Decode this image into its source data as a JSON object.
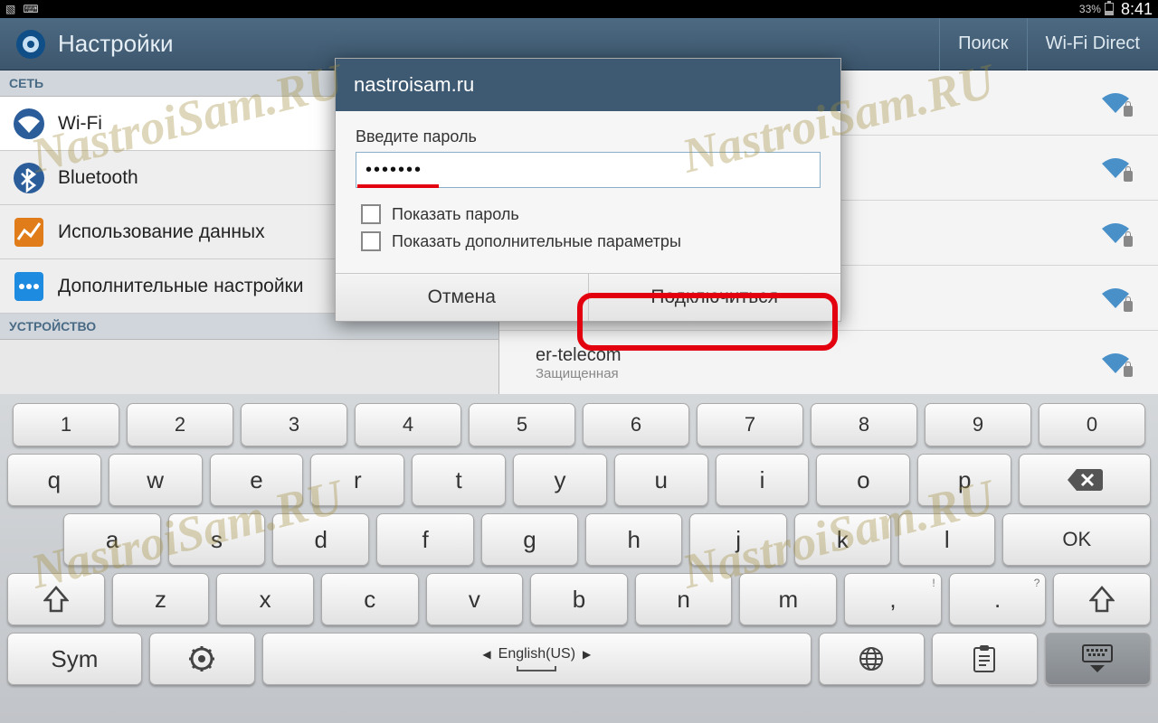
{
  "statusbar": {
    "battery_pct": "33%",
    "time": "8:41"
  },
  "actionbar": {
    "title": "Настройки",
    "search": "Поиск",
    "wifidirect": "Wi-Fi Direct"
  },
  "sections": {
    "network": "СЕТЬ",
    "device": "УСТРОЙСТВО"
  },
  "settings_items": {
    "wifi": "Wi-Fi",
    "bluetooth": "Bluetooth",
    "data_usage": "Использование данных",
    "more": "Дополнительные настройки"
  },
  "wifi_list": {
    "visible_network": {
      "ssid": "er-telecom",
      "status": "Защищенная"
    }
  },
  "dialog": {
    "title": "nastroisam.ru",
    "password_label": "Введите пароль",
    "password_value": "•••••••",
    "show_password": "Показать пароль",
    "show_advanced": "Показать дополнительные параметры",
    "cancel": "Отмена",
    "connect": "Подключиться"
  },
  "keyboard": {
    "row_num": [
      "1",
      "2",
      "3",
      "4",
      "5",
      "6",
      "7",
      "8",
      "9",
      "0"
    ],
    "row1": [
      "q",
      "w",
      "e",
      "r",
      "t",
      "y",
      "u",
      "i",
      "o",
      "p"
    ],
    "row2": [
      "a",
      "s",
      "d",
      "f",
      "g",
      "h",
      "j",
      "k",
      "l"
    ],
    "row3": [
      "z",
      "x",
      "c",
      "v",
      "b",
      "n",
      "m"
    ],
    "comma": ", !",
    "period": ". ?",
    "ok": "OK",
    "sym": "Sym",
    "space_lang": "English(US)"
  },
  "watermark": "NastroiSam.RU"
}
